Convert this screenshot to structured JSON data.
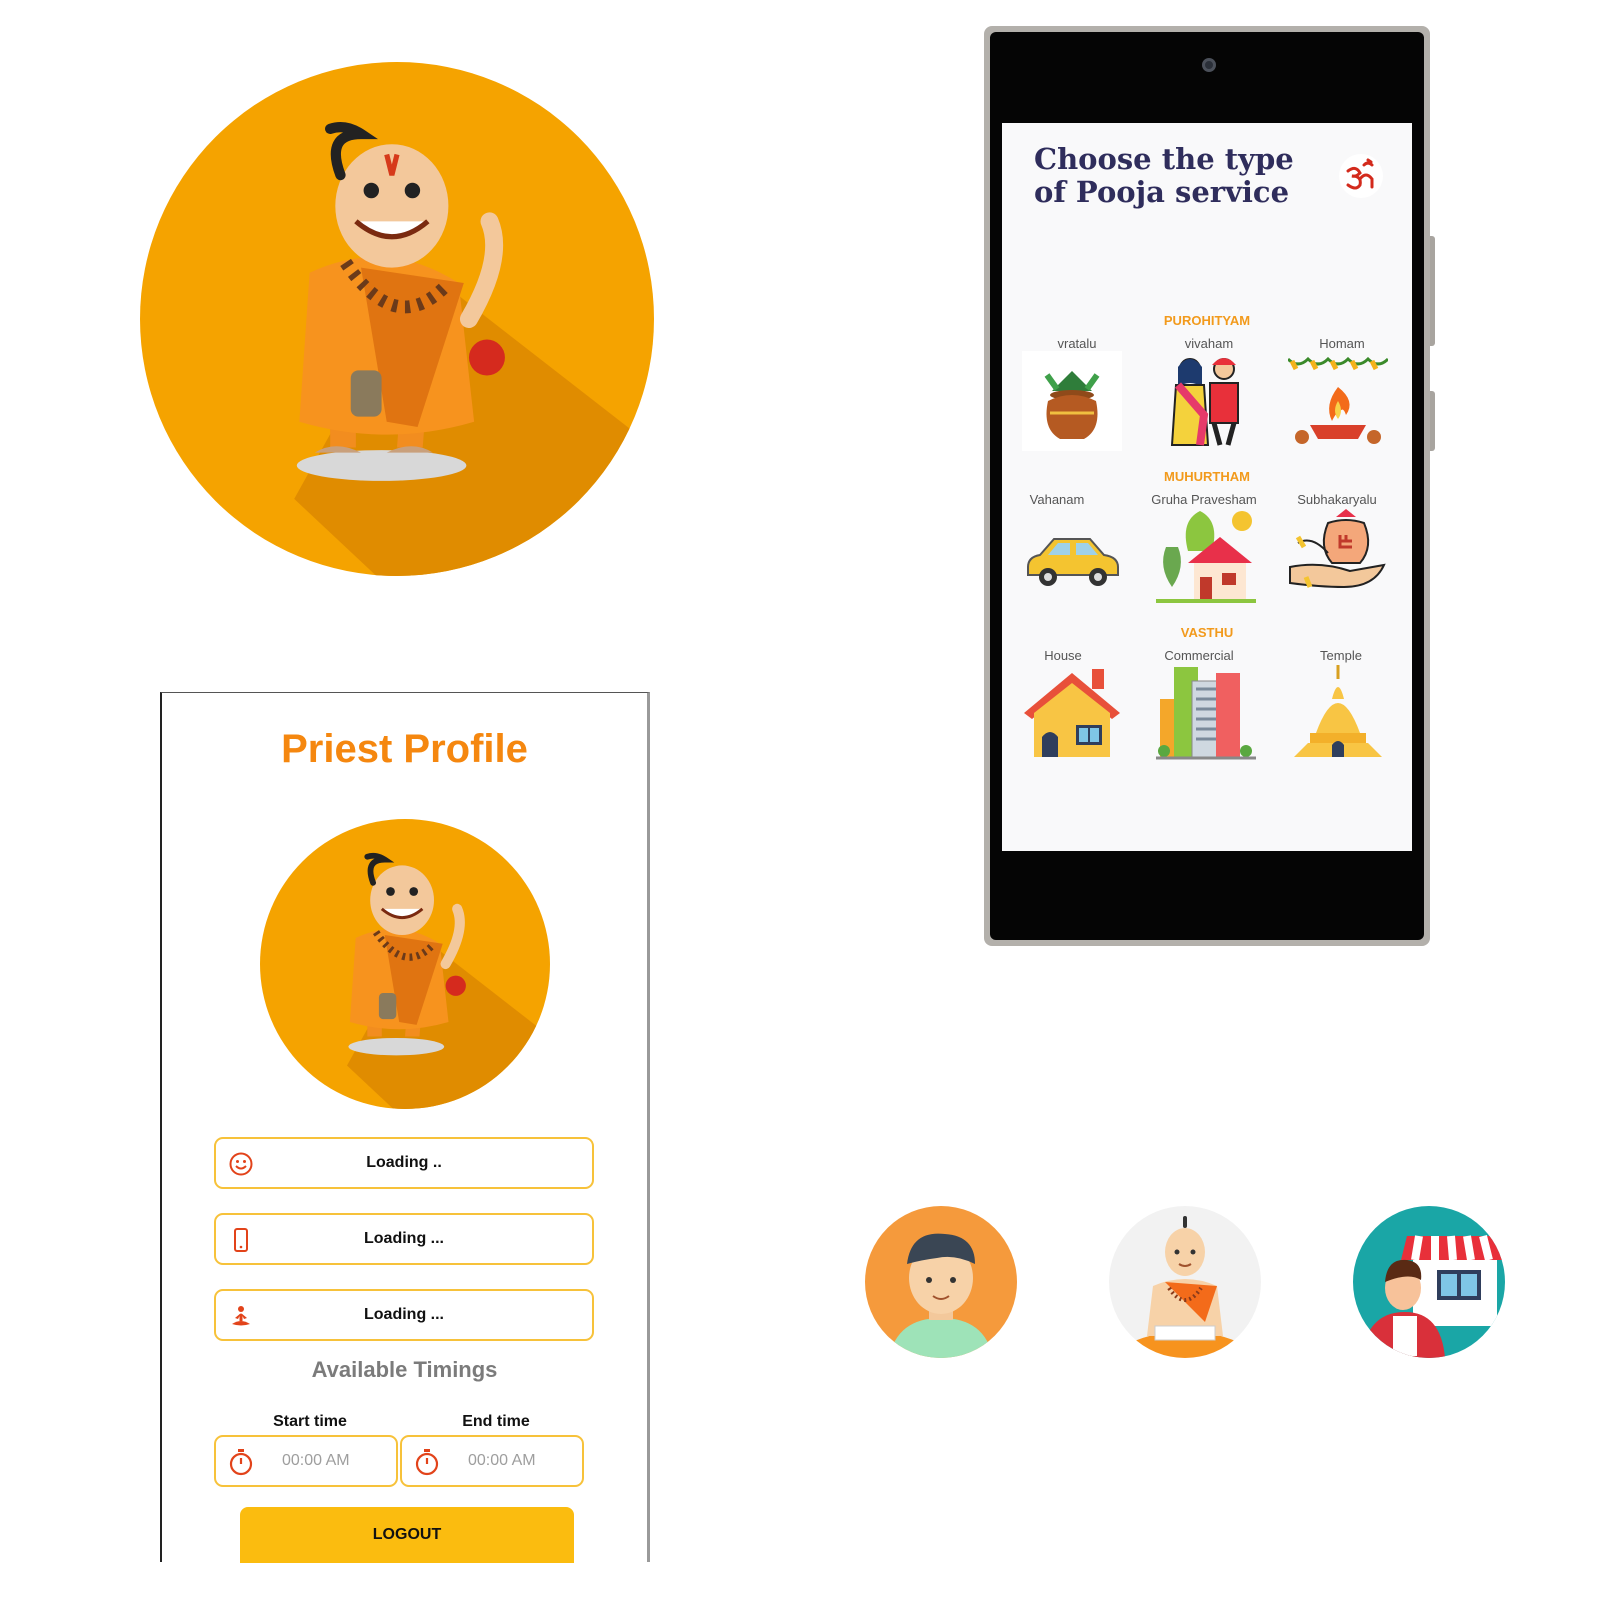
{
  "colors": {
    "brand_orange": "#f5a300",
    "accent_orange": "#f5870f",
    "field_border": "#f7c23a",
    "button_yellow": "#fbbc0f",
    "icon_red": "#e2431a",
    "title_navy": "#2f2d5c"
  },
  "profile": {
    "title": "Priest Profile",
    "fields": [
      {
        "icon": "smiley-icon",
        "value": "Loading .."
      },
      {
        "icon": "phone-icon",
        "value": "Loading ..."
      },
      {
        "icon": "meditation-icon",
        "value": "Loading ..."
      }
    ],
    "timings_title": "Available Timings",
    "start_label": "Start time",
    "end_label": "End time",
    "start_value": "00:00 AM",
    "end_value": "00:00 AM",
    "timer_icon": "stopwatch-icon",
    "logout_label": "LOGOUT"
  },
  "service_screen": {
    "title_line1": "Choose the type",
    "title_line2": "of Pooja service",
    "logo_icon": "om-icon",
    "sections": [
      {
        "heading": "PUROHITYAM",
        "items": [
          {
            "label": "vratalu",
            "icon": "kalash-icon"
          },
          {
            "label": "vivaham",
            "icon": "wedding-couple-icon"
          },
          {
            "label": "Homam",
            "icon": "sacred-fire-icon"
          }
        ]
      },
      {
        "heading": "MUHURTHAM",
        "items": [
          {
            "label": "Vahanam",
            "icon": "car-icon"
          },
          {
            "label": "Gruha Pravesham",
            "icon": "house-with-trees-icon"
          },
          {
            "label": "Subhakaryalu",
            "icon": "offering-hands-icon"
          }
        ]
      },
      {
        "heading": "VASTHU",
        "items": [
          {
            "label": "House",
            "icon": "house-icon"
          },
          {
            "label": "Commercial",
            "icon": "buildings-icon"
          },
          {
            "label": "Temple",
            "icon": "temple-icon"
          }
        ]
      }
    ]
  },
  "user_types": [
    {
      "icon": "customer-avatar-icon"
    },
    {
      "icon": "priest-avatar-icon"
    },
    {
      "icon": "shop-vendor-avatar-icon"
    }
  ]
}
